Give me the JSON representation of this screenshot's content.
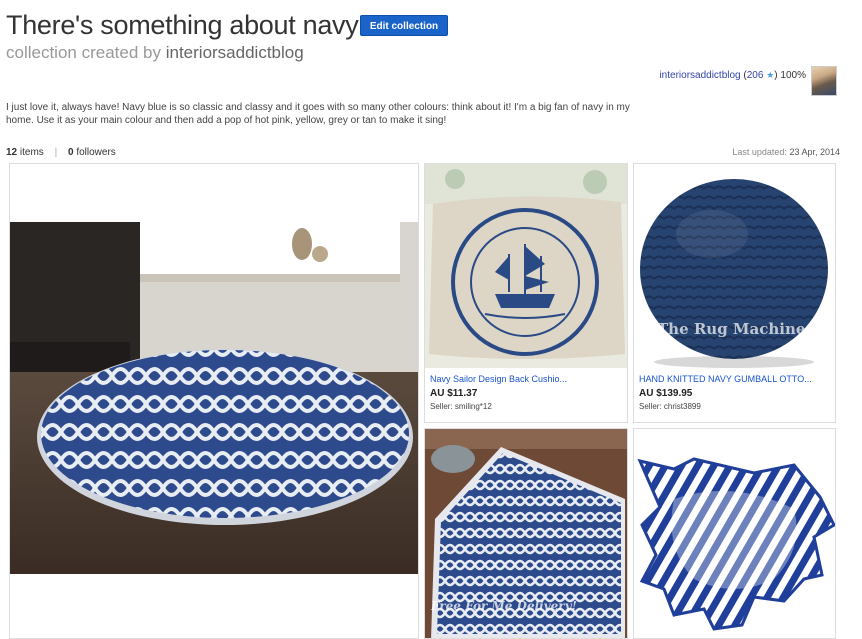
{
  "header": {
    "title": "There's something about navy",
    "edit_button": "Edit collection",
    "subtitle_prefix": "collection created by",
    "creator": "interiorsaddictblog"
  },
  "user": {
    "name": "interiorsaddictblog",
    "open_paren": "(",
    "score": "206",
    "star_icon": "star-icon",
    "close_paren": ")",
    "feedback": "100%"
  },
  "description": "I just love it, always have! Navy blue is so classic and classy and it goes with so many other colours: think about it! I'm a big fan of navy in my home. Use it as your main colour and then add a pop of hot pink, yellow, grey or tan to make it sing!",
  "stats": {
    "items_count": "12",
    "items_label": "items",
    "separator": "|",
    "followers_count": "0",
    "followers_label": "followers"
  },
  "updated": {
    "label": "Last updated:",
    "date": "23 Apr, 2014"
  },
  "items": [
    {
      "title": "",
      "price": "",
      "seller": ""
    },
    {
      "title": "Navy Sailor Design Back Cushio...",
      "price": "AU $11.37",
      "seller": "Seller: smiling*12"
    },
    {
      "title": "HAND KNITTED NAVY GUMBALL OTTO...",
      "price": "AU $139.95",
      "seller": "Seller: christ3899",
      "watermark": "©The Rug Machine"
    },
    {
      "title": "",
      "price": "",
      "seller": "",
      "watermark": "Free For Me Delivery!"
    },
    {
      "title": "",
      "price": "",
      "seller": ""
    }
  ],
  "colors": {
    "accent": "#1a63c8",
    "navy": "#2a4a86",
    "link": "#1a55cc"
  }
}
